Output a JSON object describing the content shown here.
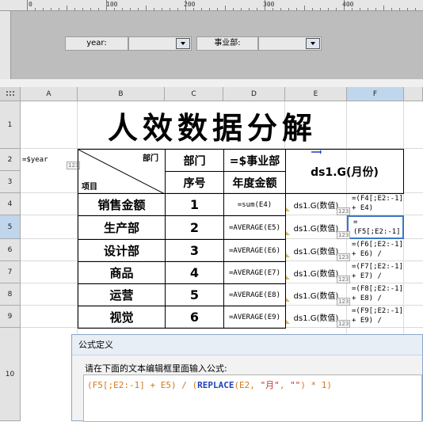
{
  "param_pane": {
    "ruler_numbers": [
      "0",
      "100",
      "200",
      "300",
      "400"
    ],
    "year_label": "year:",
    "year_value": "",
    "dept_label": "事业部:",
    "dept_value": ""
  },
  "grid": {
    "columns": [
      "A",
      "B",
      "C",
      "D",
      "E",
      "F"
    ],
    "rows": [
      "1",
      "2",
      "3",
      "4",
      "5",
      "6",
      "7",
      "8",
      "9",
      "10"
    ],
    "selected_column": "F",
    "selected_row": "5"
  },
  "report": {
    "title": "人效数据分解",
    "a2": "=$year",
    "diag_top": "部门",
    "diag_bottom": "项目",
    "c_header_top": "部门",
    "c_header_bottom": "序号",
    "d_header_top": "=$事业部",
    "d_header_bottom": "年度金额",
    "e_header": "ds1.G(月份)",
    "rows": [
      {
        "item": "销售金额",
        "seq": "1",
        "d": "=sum(E4)",
        "e": "ds1.G(数值)",
        "f": "=(F4[;E2:-1] + E4)"
      },
      {
        "item": "生产部",
        "seq": "2",
        "d": "=AVERAGE(E5)",
        "e": "ds1.G(数值)",
        "f": "=(F5[;E2:-1] + E5) /"
      },
      {
        "item": "设计部",
        "seq": "3",
        "d": "=AVERAGE(E6)",
        "e": "ds1.G(数值)",
        "f": "=(F6[;E2:-1] + E6) /"
      },
      {
        "item": "商品",
        "seq": "4",
        "d": "=AVERAGE(E7)",
        "e": "ds1.G(数值)",
        "f": "=(F7[;E2:-1] + E7) /"
      },
      {
        "item": "运营",
        "seq": "5",
        "d": "=AVERAGE(E8)",
        "e": "ds1.G(数值)",
        "f": "=(F8[;E2:-1] + E8) /"
      },
      {
        "item": "视觉",
        "seq": "6",
        "d": "=AVERAGE(E9)",
        "e": "ds1.G(数值)",
        "f": "=(F9[;E2:-1] + E9) /"
      }
    ]
  },
  "dialog": {
    "title": "公式定义",
    "prompt": "请在下面的文本编辑框里面输入公式:",
    "formula": {
      "part1": "(F5[;E2:-1] + E5) / (",
      "func": "REPLACE",
      "part2": "(E2, ",
      "str1": "\"月\"",
      "part3": ", ",
      "str2": "\"\"",
      "part4": ") * 1)"
    }
  },
  "colors": {
    "header_bg": "#e3e3e3",
    "selected_header_bg": "#bfd6ec",
    "param_bg": "#bdbdbd",
    "selection_border": "#3a78c8",
    "formula_orange": "#d4781a",
    "formula_blue": "#2040c0",
    "formula_red": "#c03030"
  }
}
